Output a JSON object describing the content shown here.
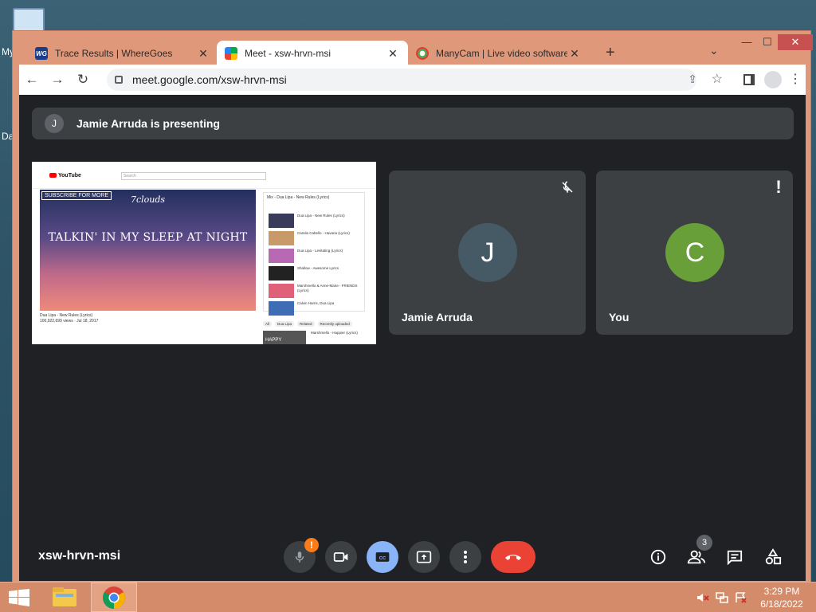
{
  "desktop": {
    "labels": [
      "My",
      "Da"
    ]
  },
  "browser": {
    "tabs": [
      {
        "title": "Trace Results | WhereGoes",
        "favicon": "wheregoes-icon",
        "fav_text": "WG"
      },
      {
        "title": "Meet - xsw-hrvn-msi",
        "favicon": "google-meet-icon"
      },
      {
        "title": "ManyCam | Live video software & ",
        "favicon": "manycam-icon"
      }
    ],
    "new_tab": "+",
    "tab_search": "⌄",
    "window_controls": {
      "minimize": "—",
      "maximize": "☐",
      "close": "✕"
    },
    "url": "meet.google.com/xsw-hrvn-msi",
    "nav": {
      "back": "←",
      "forward": "→",
      "reload": "↻"
    },
    "star": "☆",
    "share": "⇪",
    "menu": "⋮"
  },
  "meet": {
    "presenting_banner": {
      "avatar_letter": "J",
      "text": "Jamie Arruda is presenting"
    },
    "shared_screen": {
      "site": "YouTube",
      "search_placeholder": "Search",
      "subscribe": "SUBSCRIBE FOR MORE",
      "brand": "7clouds",
      "lyric": "TALKIN' IN MY SLEEP AT NIGHT",
      "caption": "Dua Lipa - New Rules (Lyrics)",
      "views": "100,922,699 views · Jul 18, 2017",
      "playlist_title": "Mix - Dua Lipa - New Rules (Lyrics)",
      "playlist_items": [
        {
          "title": "Dua Lipa - New Rules (Lyrics)",
          "color": "#3a3a5a"
        },
        {
          "title": "Camila Cabello - Havana (Lyrics)",
          "color": "#c89a6a"
        },
        {
          "title": "Dua Lipa - Levitating (Lyrics)",
          "color": "#b76ab3"
        },
        {
          "title": "Shallow - Awesome Lyrics",
          "color": "#222"
        },
        {
          "title": "Marshmello & Anne-Marie - FRIENDS (Lyrics)",
          "color": "#e0607a"
        },
        {
          "title": "Calvin Harris, Dua Lipa",
          "color": "#3e6db5"
        }
      ],
      "chips": [
        "All",
        "Dua Lipa",
        "Related",
        "Recently uploaded"
      ],
      "next_label": "HAPPY",
      "next_text": "Marshmello - Happier (Lyrics)"
    },
    "participants": [
      {
        "name": "Jamie Arruda",
        "letter": "J",
        "status_icon": "mic-off-icon"
      },
      {
        "name": "You",
        "letter": "C",
        "status_icon": "alert-icon"
      }
    ],
    "alert_glyph": "!",
    "meeting_code": "xsw-hrvn-msi",
    "controls": {
      "mic_warning": "!",
      "people_count": "3"
    }
  },
  "taskbar": {
    "time": "3:29 PM",
    "date": "6/18/2022"
  },
  "colors": {
    "window_frame": "#e0987a",
    "meet_bg": "#202124",
    "tile_bg": "#3c4043",
    "end_call": "#ea4335",
    "cc_active": "#8ab4f8",
    "mic_warning": "#fa7b17",
    "you_avatar": "#689f38",
    "jamie_avatar": "#455a64"
  }
}
